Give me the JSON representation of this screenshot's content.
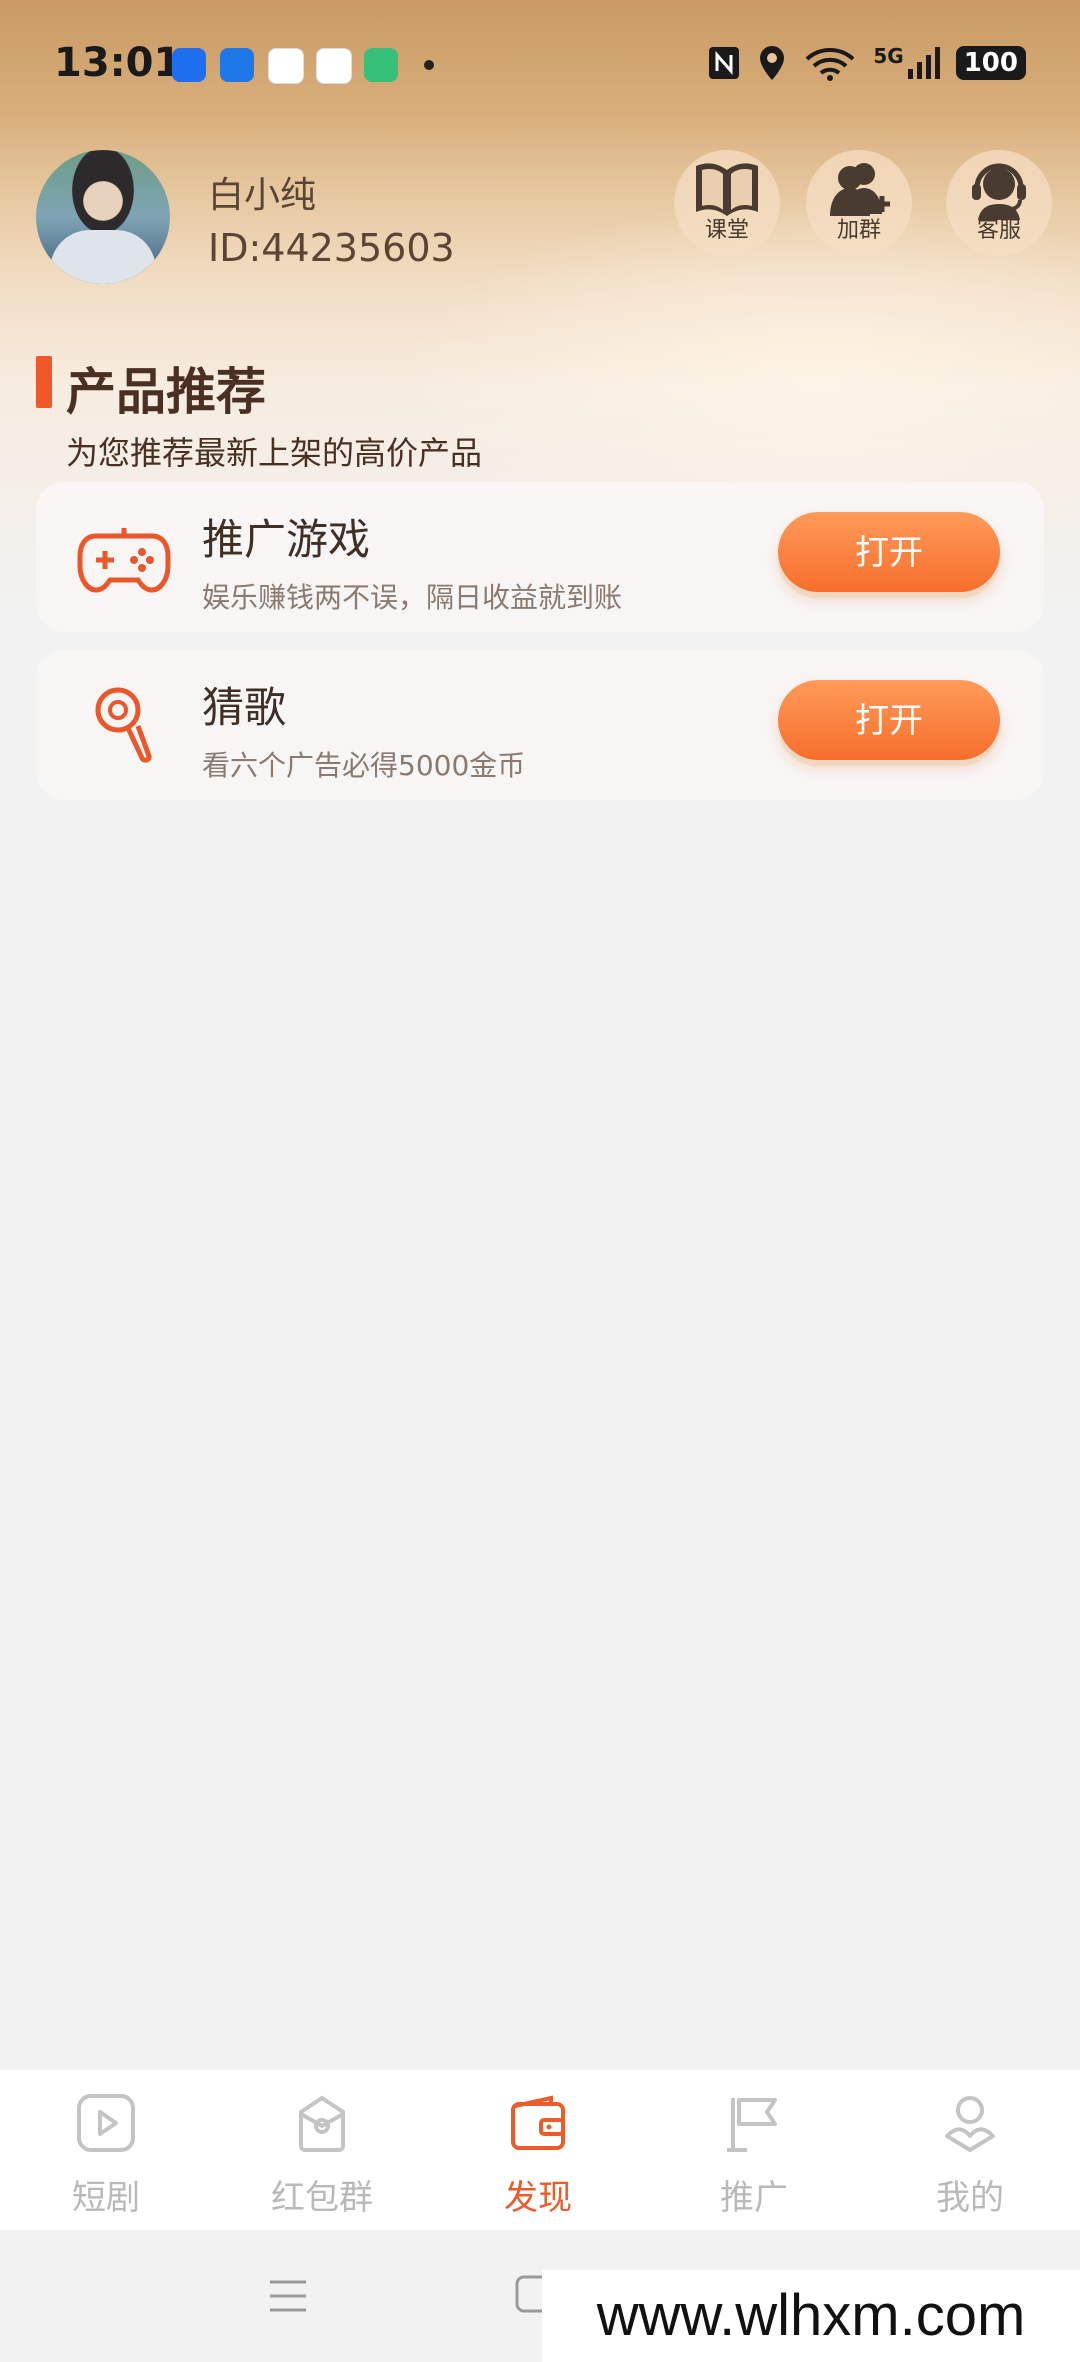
{
  "status_bar": {
    "time": "13:01",
    "network": "5G",
    "battery": "100"
  },
  "colors": {
    "accent": "#f0582a",
    "button": "#f76e2c",
    "tab_active": "#ec5b2a",
    "tab_inactive": "#b9b9b9"
  },
  "user": {
    "name": "白小纯",
    "id_text": "ID:44235603"
  },
  "quick_actions": [
    {
      "label": "课堂",
      "icon": "book-icon"
    },
    {
      "label": "加群",
      "icon": "add-group-icon"
    },
    {
      "label": "客服",
      "icon": "customer-service-icon"
    }
  ],
  "section": {
    "title": "产品推荐",
    "subtitle": "为您推荐最新上架的高价产品"
  },
  "products": [
    {
      "title": "推广游戏",
      "desc": "娱乐赚钱两不误，隔日收益就到账",
      "button": "打开",
      "icon": "gamepad-icon"
    },
    {
      "title": "猜歌",
      "desc": "看六个广告必得5000金币",
      "button": "打开",
      "icon": "magnifier-icon"
    }
  ],
  "tabs": [
    {
      "label": "短剧",
      "icon": "play-icon",
      "active": false
    },
    {
      "label": "红包群",
      "icon": "red-packet-icon",
      "active": false
    },
    {
      "label": "发现",
      "icon": "wallet-icon",
      "active": true
    },
    {
      "label": "推广",
      "icon": "flag-icon",
      "active": false
    },
    {
      "label": "我的",
      "icon": "profile-icon",
      "active": false
    }
  ],
  "watermark": "www.wlhxm.com"
}
